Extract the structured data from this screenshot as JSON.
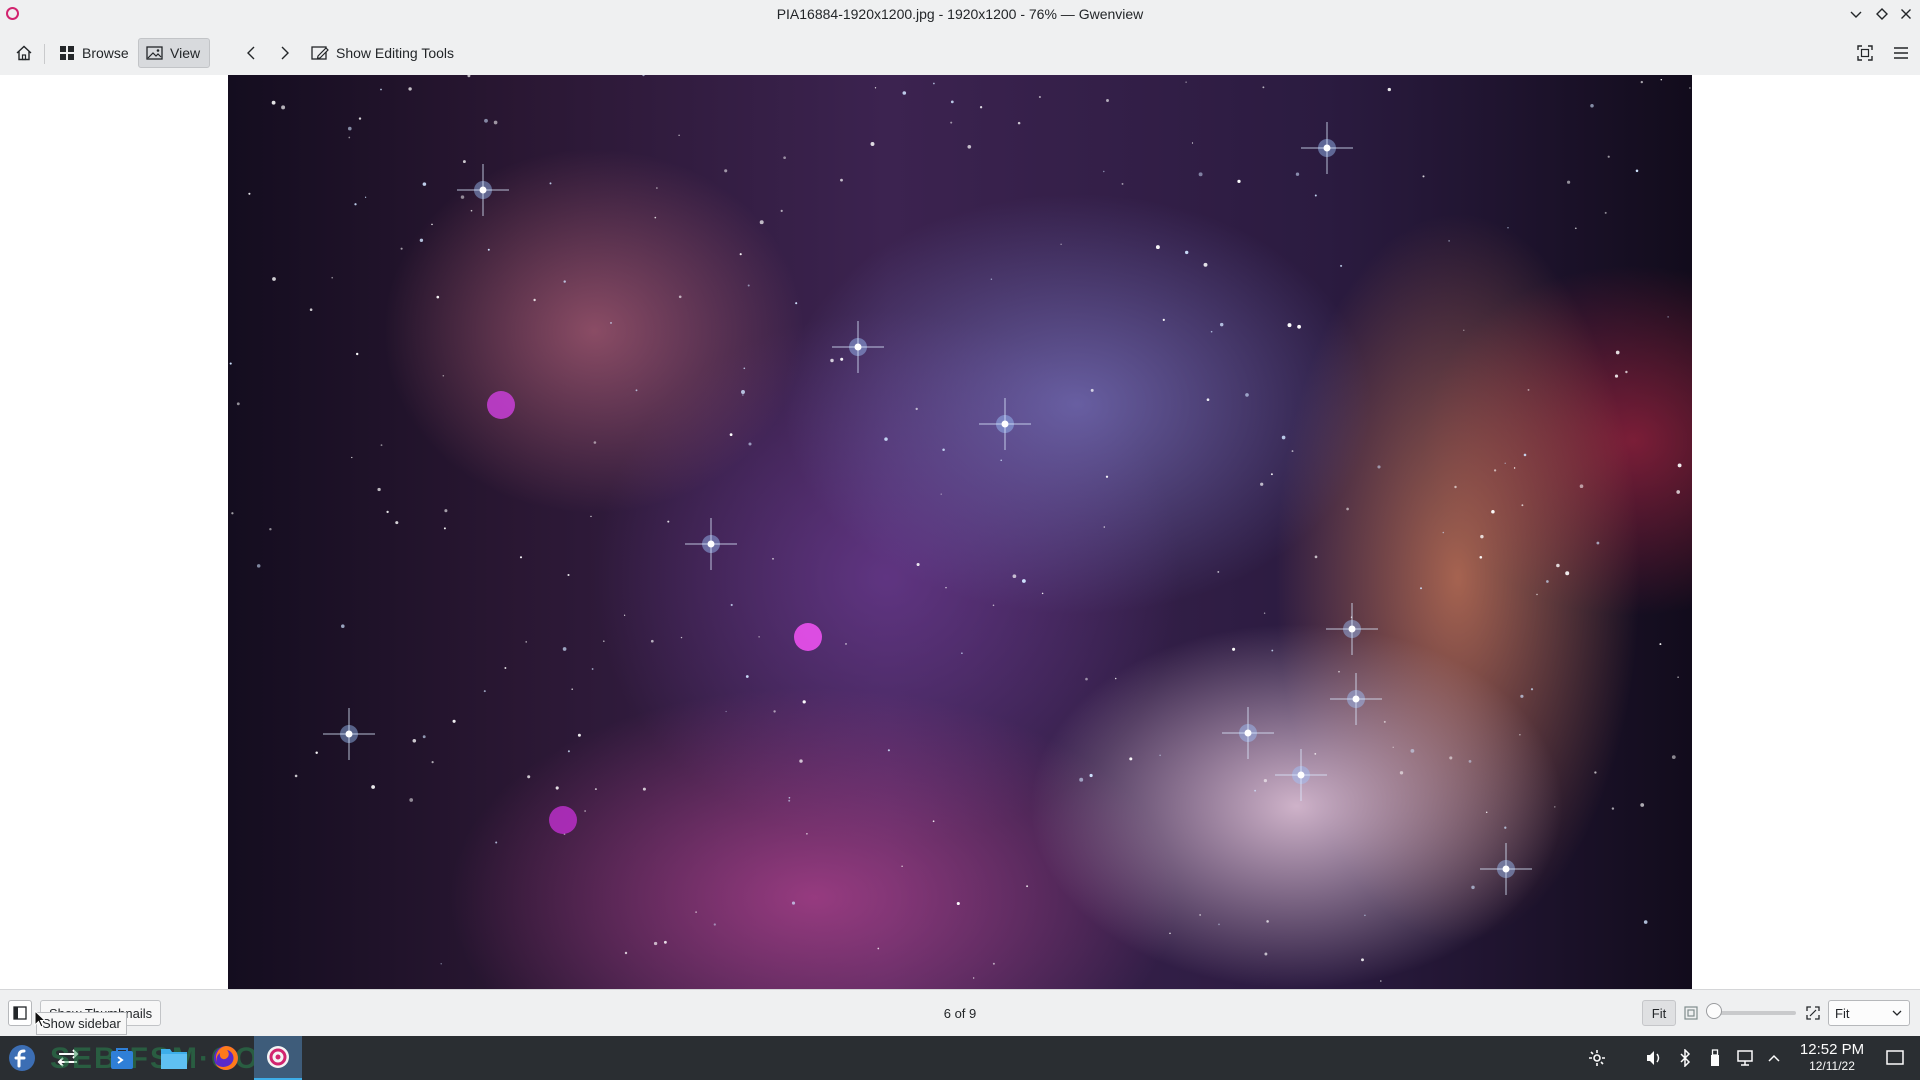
{
  "window": {
    "title": "PIA16884-1920x1200.jpg - 1920x1200 - 76% — Gwenview"
  },
  "toolbar": {
    "browse_label": "Browse",
    "view_label": "View",
    "editing_tools_label": "Show Editing Tools"
  },
  "statusbar": {
    "thumbnails_label": "Show Thumbnails",
    "sidebar_tooltip": "Show sidebar",
    "counter": "6 of 9",
    "fit_label": "Fit",
    "zoom_mode": "Fit",
    "zoom_slider_fraction": 0.0
  },
  "taskbar": {
    "watermark": "SEB·FSM·COM",
    "time": "12:52 PM",
    "date": "12/11/22"
  },
  "colors": {
    "chrome_bg": "#eff0f1",
    "taskbar_bg": "#2a2e32",
    "accent": "#3daee9",
    "app_icon": "#d2246f"
  }
}
